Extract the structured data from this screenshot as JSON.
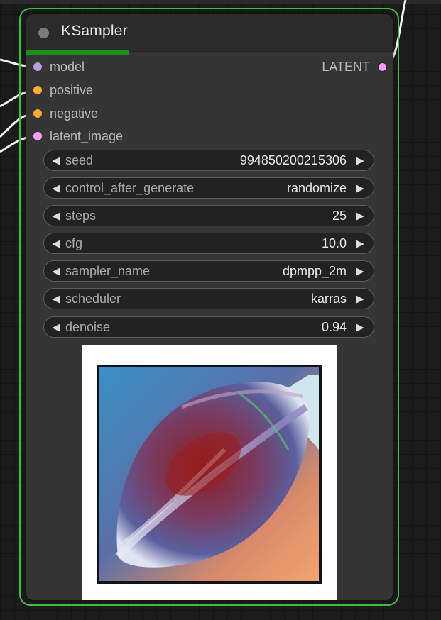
{
  "node": {
    "title": "KSampler",
    "progress": 0.28,
    "inputs": [
      {
        "label": "model",
        "color": "#b39ddb"
      },
      {
        "label": "positive",
        "color": "#ffa931"
      },
      {
        "label": "negative",
        "color": "#ffa931"
      },
      {
        "label": "latent_image",
        "color": "#ff9cf9"
      }
    ],
    "output": {
      "label": "LATENT",
      "color": "#ff9cf9"
    },
    "widgets": [
      {
        "label": "seed",
        "value": "994850200215306"
      },
      {
        "label": "control_after_generate",
        "value": "randomize"
      },
      {
        "label": "steps",
        "value": "25"
      },
      {
        "label": "cfg",
        "value": "10.0"
      },
      {
        "label": "sampler_name",
        "value": "dpmpp_2m"
      },
      {
        "label": "scheduler",
        "value": "karras"
      },
      {
        "label": "denoise",
        "value": "0.94"
      }
    ]
  },
  "icons": {
    "arrow_left": "◀",
    "arrow_right": "▶",
    "collapse": "collapse-dot-icon"
  },
  "colors": {
    "selection_outline": "#3fbf3f",
    "progress": "#1a8f1a",
    "node_body": "#353535",
    "widget_bg": "#222222"
  }
}
